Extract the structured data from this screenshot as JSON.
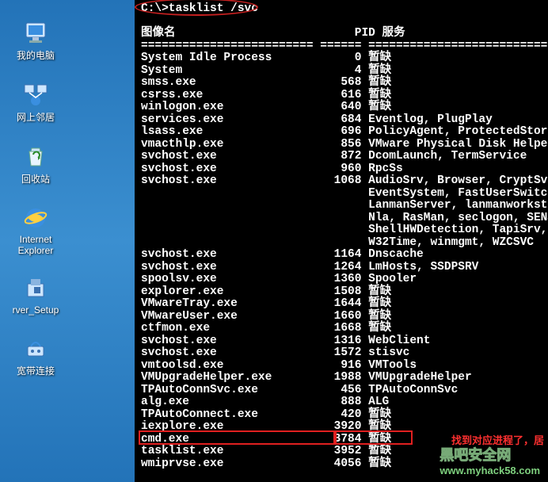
{
  "desktop": {
    "icons": [
      {
        "id": "my-computer",
        "label": "我的电脑",
        "glyph": "computer"
      },
      {
        "id": "network",
        "label": "网上邻居",
        "glyph": "network"
      },
      {
        "id": "recycle",
        "label": "回收站",
        "glyph": "recycle"
      },
      {
        "id": "ie",
        "label": "Internet\nExplorer",
        "glyph": "ie"
      },
      {
        "id": "setup",
        "label": "rver_Setup",
        "glyph": "setup"
      },
      {
        "id": "dialup",
        "label": "宽带连接",
        "glyph": "dialup"
      }
    ]
  },
  "terminal": {
    "command": "C:\\>tasklist /svc",
    "headers": {
      "image": "图像名",
      "pid": "PID",
      "services": "服务"
    },
    "separator": {
      "image": "=========================",
      "pid": "======",
      "services": "==========================="
    },
    "col_widths": {
      "image": 26,
      "pid": 6
    },
    "rows": [
      {
        "image": "System Idle Process",
        "pid": 0,
        "services": "暂缺"
      },
      {
        "image": "System",
        "pid": 4,
        "services": "暂缺"
      },
      {
        "image": "smss.exe",
        "pid": 568,
        "services": "暂缺"
      },
      {
        "image": "csrss.exe",
        "pid": 616,
        "services": "暂缺"
      },
      {
        "image": "winlogon.exe",
        "pid": 640,
        "services": "暂缺"
      },
      {
        "image": "services.exe",
        "pid": 684,
        "services": "Eventlog, PlugPlay"
      },
      {
        "image": "lsass.exe",
        "pid": 696,
        "services": "PolicyAgent, ProtectedStorage, S"
      },
      {
        "image": "vmacthlp.exe",
        "pid": 856,
        "services": "VMware Physical Disk Helper Serv"
      },
      {
        "image": "svchost.exe",
        "pid": 872,
        "services": "DcomLaunch, TermService"
      },
      {
        "image": "svchost.exe",
        "pid": 960,
        "services": "RpcSs"
      },
      {
        "image": "svchost.exe",
        "pid": 1068,
        "services": "AudioSrv, Browser, CryptSvc, Dhc"
      },
      {
        "image": "",
        "pid": "",
        "services": "EventSystem, FastUserSwitchingCo"
      },
      {
        "image": "",
        "pid": "",
        "services": "LanmanServer, lanmanworkstation,"
      },
      {
        "image": "",
        "pid": "",
        "services": "Nla, RasMan, seclogon, SENS, Sha"
      },
      {
        "image": "",
        "pid": "",
        "services": "ShellHWDetection, TapiSrv, Theme"
      },
      {
        "image": "",
        "pid": "",
        "services": "W32Time, winmgmt, WZCSVC"
      },
      {
        "image": "svchost.exe",
        "pid": 1164,
        "services": "Dnscache"
      },
      {
        "image": "svchost.exe",
        "pid": 1264,
        "services": "LmHosts, SSDPSRV"
      },
      {
        "image": "spoolsv.exe",
        "pid": 1360,
        "services": "Spooler"
      },
      {
        "image": "explorer.exe",
        "pid": 1508,
        "services": "暂缺"
      },
      {
        "image": "VMwareTray.exe",
        "pid": 1644,
        "services": "暂缺"
      },
      {
        "image": "VMwareUser.exe",
        "pid": 1660,
        "services": "暂缺"
      },
      {
        "image": "ctfmon.exe",
        "pid": 1668,
        "services": "暂缺"
      },
      {
        "image": "svchost.exe",
        "pid": 1316,
        "services": "WebClient"
      },
      {
        "image": "svchost.exe",
        "pid": 1572,
        "services": "stisvc"
      },
      {
        "image": "vmtoolsd.exe",
        "pid": 916,
        "services": "VMTools"
      },
      {
        "image": "VMUpgradeHelper.exe",
        "pid": 1988,
        "services": "VMUpgradeHelper"
      },
      {
        "image": "TPAutoConnSvc.exe",
        "pid": 456,
        "services": "TPAutoConnSvc"
      },
      {
        "image": "alg.exe",
        "pid": 888,
        "services": "ALG"
      },
      {
        "image": "TPAutoConnect.exe",
        "pid": 420,
        "services": "暂缺"
      },
      {
        "image": "iexplore.exe",
        "pid": 3920,
        "services": "暂缺"
      },
      {
        "image": "cmd.exe",
        "pid": 3784,
        "services": "暂缺"
      },
      {
        "image": "tasklist.exe",
        "pid": 3952,
        "services": "暂缺"
      },
      {
        "image": "wmiprvse.exe",
        "pid": 4056,
        "services": "暂缺"
      }
    ]
  },
  "annotation": "找到对应进程了，居",
  "watermark": {
    "line1": "黑吧安全网",
    "line2": "www.myhack58.com"
  },
  "colors": {
    "highlight": "#e02020",
    "terminal_bg": "#000000",
    "terminal_fg": "#ffffff"
  }
}
